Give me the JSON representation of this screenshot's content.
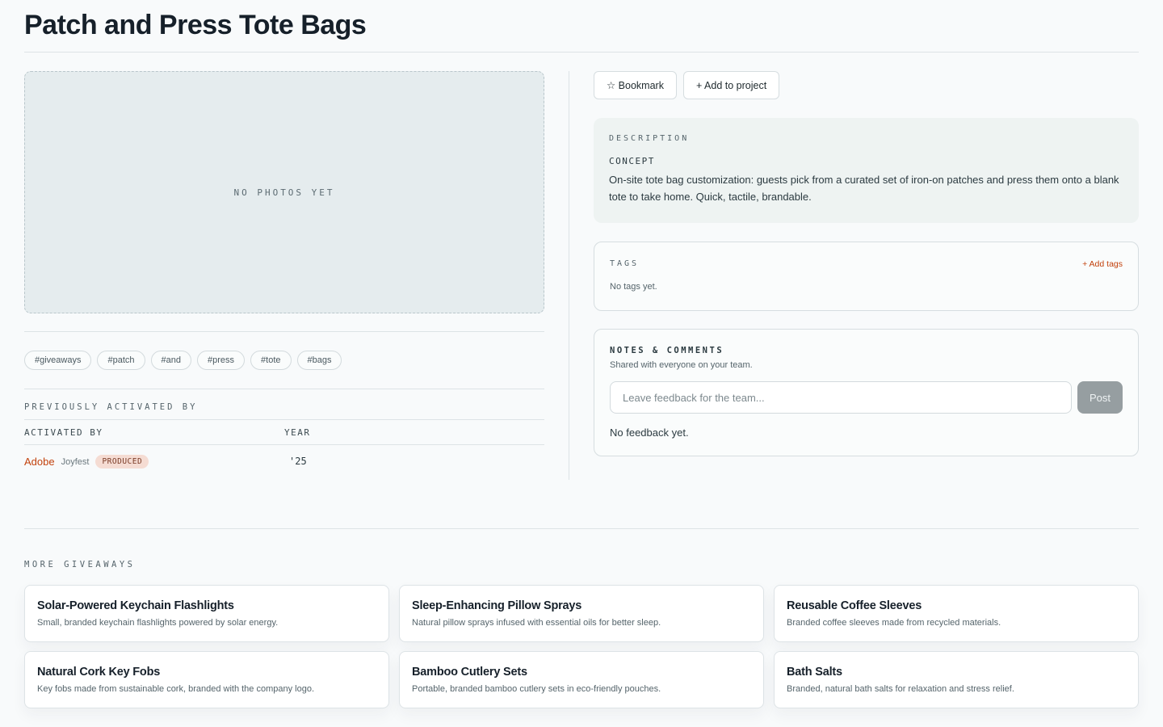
{
  "page": {
    "title": "Patch and Press Tote Bags"
  },
  "photos": {
    "empty_label": "NO PHOTOS YET"
  },
  "hashtags": [
    "#giveaways",
    "#patch",
    "#and",
    "#press",
    "#tote",
    "#bags"
  ],
  "previously_activated": {
    "heading": "PREVIOUSLY ACTIVATED BY",
    "columns": {
      "activated_by": "ACTIVATED BY",
      "year": "YEAR"
    },
    "rows": [
      {
        "brand": "Adobe",
        "event": "Joyfest",
        "status": "PRODUCED",
        "year": "'25"
      }
    ]
  },
  "actions": {
    "bookmark": "☆ Bookmark",
    "add_to_project": "+ Add to project"
  },
  "description": {
    "label": "DESCRIPTION",
    "concept_label": "CONCEPT",
    "concept_text": "On-site tote bag customization: guests pick from a curated set of iron-on patches and press them onto a blank tote to take home. Quick, tactile, brandable."
  },
  "tags": {
    "label": "TAGS",
    "add_label": "+ Add tags",
    "empty": "No tags yet."
  },
  "notes": {
    "title": "NOTES & COMMENTS",
    "subtitle": "Shared with everyone on your team.",
    "input_placeholder": "Leave feedback for the team...",
    "post_label": "Post",
    "empty": "No feedback yet."
  },
  "more": {
    "heading": "MORE GIVEAWAYS",
    "items": [
      {
        "title": "Solar-Powered Keychain Flashlights",
        "desc": "Small, branded keychain flashlights powered by solar energy."
      },
      {
        "title": "Sleep-Enhancing Pillow Sprays",
        "desc": "Natural pillow sprays infused with essential oils for better sleep."
      },
      {
        "title": "Reusable Coffee Sleeves",
        "desc": "Branded coffee sleeves made from recycled materials."
      },
      {
        "title": "Natural Cork Key Fobs",
        "desc": "Key fobs made from sustainable cork, branded with the company logo."
      },
      {
        "title": "Bamboo Cutlery Sets",
        "desc": "Portable, branded bamboo cutlery sets in eco-friendly pouches."
      },
      {
        "title": "Bath Salts",
        "desc": "Branded, natural bath salts for relaxation and stress relief."
      }
    ]
  },
  "colors": {
    "accent": "#c2410c",
    "badge_bg": "#f5dcd3",
    "post_button": "#969ea1"
  }
}
